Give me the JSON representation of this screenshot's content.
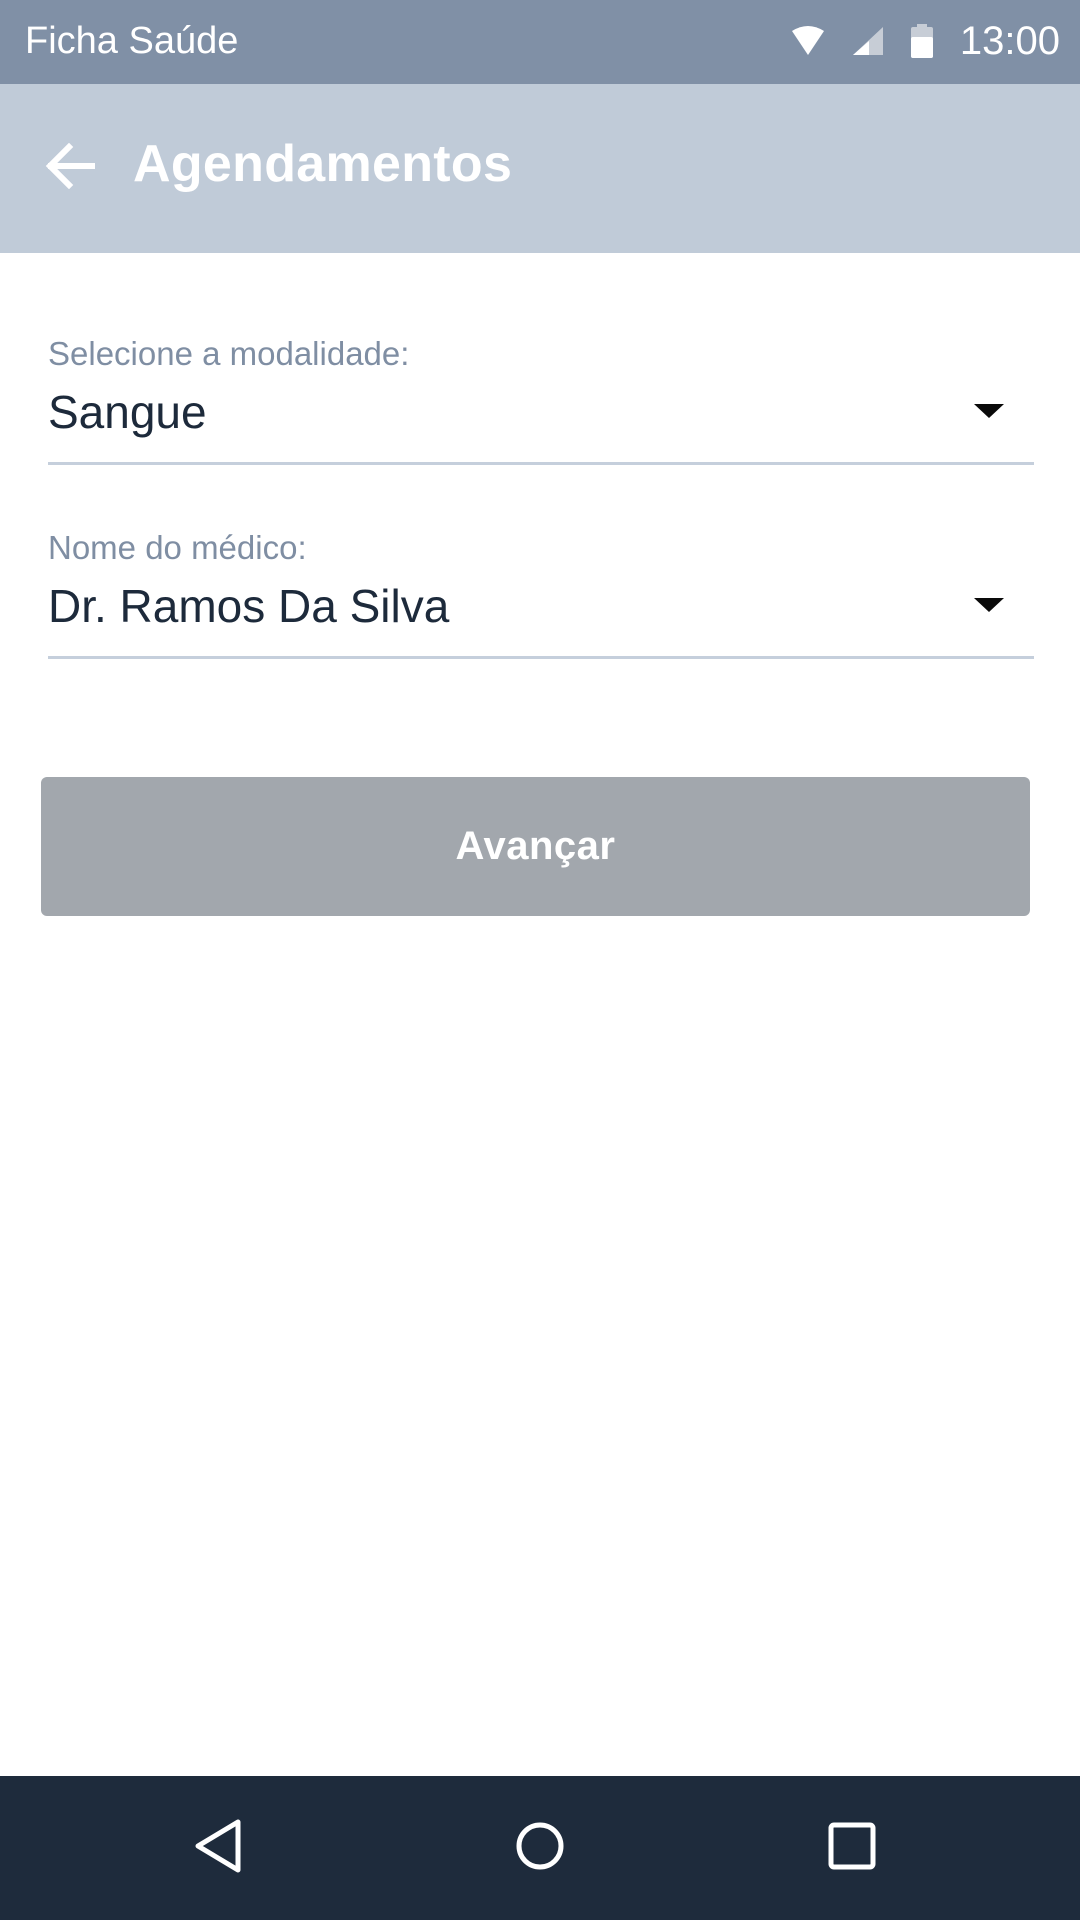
{
  "status_bar": {
    "app_name": "Ficha Saúde",
    "time": "13:00",
    "icons": [
      "wifi-icon",
      "signal-icon",
      "battery-icon"
    ]
  },
  "app_bar": {
    "back_icon": "arrow-left-icon",
    "title": "Agendamentos",
    "background": "#c0cbd8"
  },
  "form": {
    "modalidade": {
      "label": "Selecione a modalidade:",
      "value": "Sangue"
    },
    "medico": {
      "label": "Nome do médico:",
      "value": "Dr. Ramos Da Silva"
    },
    "submit_label": "Avançar",
    "submit_color": "#a2a7ad"
  },
  "nav_bar": {
    "icons": [
      "nav-back-icon",
      "nav-home-icon",
      "nav-recents-icon"
    ],
    "background": "#1e2b3c"
  }
}
